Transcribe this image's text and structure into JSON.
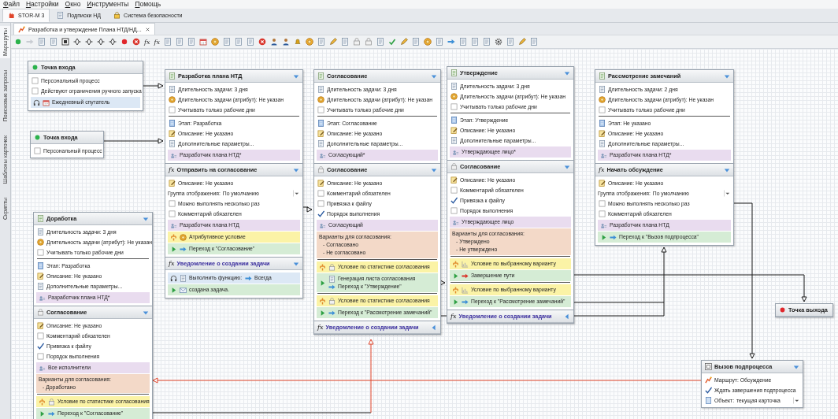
{
  "menu": [
    "Файл",
    "Настройки",
    "Окно",
    "Инструменты",
    "Помощь"
  ],
  "app_tabs": [
    {
      "label": "STOR-M 3",
      "selected": true
    },
    {
      "label": "Подписки НД",
      "selected": false
    },
    {
      "label": "Система безопасности",
      "selected": false
    }
  ],
  "sidebar": [
    {
      "label": "Маршруты",
      "selected": true
    },
    {
      "label": "Поисковые запросы",
      "selected": false
    },
    {
      "label": "Шаблоны карточек",
      "selected": false
    },
    {
      "label": "Скрипты",
      "selected": false
    }
  ],
  "document_tab": {
    "title": "Разработка и утверждение Плана НТД/НД...",
    "selected": true
  },
  "toolbar": {
    "function_labels": [
      "fx",
      "fx"
    ]
  },
  "nodes": [
    {
      "sections": [
        {
          "kind": "entry",
          "title": "Точка входа",
          "groups": [
            [
              {
                "kind": "check",
                "text": "Персональный процесс",
                "checked": false
              },
              {
                "kind": "check",
                "text": "Действуют ограничения ручного запуска",
                "checked": false
              },
              {
                "kind": "action",
                "steps": [
                  {
                    "kind": "calendar",
                    "text": "Ежедневный спутатель"
                  }
                ]
              }
            ]
          ]
        }
      ]
    },
    {
      "sections": [
        {
          "kind": "entry",
          "title": "Точка входа",
          "groups": [
            [
              {
                "kind": "check",
                "text": "Персональный процесс",
                "checked": false
              }
            ]
          ]
        }
      ]
    },
    {
      "sections": [
        {
          "kind": "task",
          "title": "Разработка плана НТД",
          "expanded": true,
          "groups": [
            [
              {
                "kind": "duration",
                "text": "Длительность задачи: 3 дня"
              },
              {
                "kind": "attribute",
                "text": "Длительность задачи (атрибут): Не указан"
              },
              {
                "kind": "check",
                "text": "Учитывать только рабочие дни",
                "checked": false
              }
            ],
            [
              {
                "kind": "stage",
                "text": "Этап: Разработка"
              },
              {
                "kind": "description",
                "text": "Описание: Не указано"
              },
              {
                "kind": "params",
                "text": "Дополнительные параметры..."
              },
              {
                "kind": "performer",
                "text": "Разработчик плана НТД*"
              }
            ]
          ]
        },
        {
          "kind": "function",
          "icon_text": "fx",
          "title": "Отправить на согласование",
          "expanded": true,
          "groups": [
            [
              {
                "kind": "description",
                "text": "Описание: Не указано"
              },
              {
                "kind": "select",
                "label": "Группа отображения:",
                "value": "По умолчанию"
              },
              {
                "kind": "check",
                "text": "Можно выполнять несколько раз",
                "checked": false
              },
              {
                "kind": "check",
                "text": "Комментарий обязателен",
                "checked": false
              },
              {
                "kind": "performer",
                "text": "Разработчик плана НТД"
              },
              {
                "kind": "condition",
                "steps": [
                  {
                    "kind": "attribute",
                    "text": "Атрибутивное условие"
                  }
                ]
              },
              {
                "kind": "transition",
                "steps": [
                  {
                    "kind": "goto",
                    "text": "Переход к \"Согласование\""
                  }
                ]
              }
            ]
          ]
        },
        {
          "kind": "notification",
          "icon_text": "fx",
          "title": "Уведомление о создании задачи",
          "expanded": true,
          "groups": [
            [
              {
                "kind": "action",
                "steps": [
                  {
                    "kind": "function",
                    "text": "Выполнить функцию:"
                  },
                  {
                    "kind": "goto",
                    "text": "Всегда"
                  }
                ]
              },
              {
                "kind": "transition",
                "steps": [
                  {
                    "kind": "mail",
                    "text": "создана задача."
                  }
                ]
              }
            ]
          ]
        }
      ]
    },
    {
      "sections": [
        {
          "kind": "task",
          "title": "Согласование",
          "expanded": true,
          "groups": [
            [
              {
                "kind": "duration",
                "text": "Длительность задачи: 3 дня"
              },
              {
                "kind": "attribute",
                "text": "Длительность задачи (атрибут): Не указан"
              },
              {
                "kind": "check",
                "text": "Учитывать только рабочие дни",
                "checked": false
              }
            ],
            [
              {
                "kind": "stage",
                "text": "Этап: Согласование"
              },
              {
                "kind": "description",
                "text": "Описание: Не указано"
              },
              {
                "kind": "params",
                "text": "Дополнительные параметры..."
              },
              {
                "kind": "performer",
                "text": "Согласующий*"
              }
            ]
          ]
        },
        {
          "kind": "approval",
          "title": "Согласование",
          "expanded": true,
          "groups": [
            [
              {
                "kind": "description",
                "text": "Описание: Не указано"
              },
              {
                "kind": "check",
                "text": "Комментарий обязателен",
                "checked": false
              },
              {
                "kind": "check",
                "text": "Привязка к файлу",
                "checked": false
              },
              {
                "kind": "check",
                "text": "Порядок выполнения",
                "checked": true
              },
              {
                "kind": "performer",
                "text": "Согласующий"
              },
              {
                "kind": "variants",
                "title": "Варианты для согласования:",
                "options": [
                  "- Согласовано",
                  "- Не согласовано"
                ]
              }
            ],
            [
              {
                "kind": "condition",
                "steps": [
                  {
                    "kind": "statistics",
                    "text": "Условие по статистике согласования"
                  }
                ]
              },
              {
                "kind": "transition",
                "steps": [
                  {
                    "kind": "generate",
                    "text": "Генерация листа согласования"
                  },
                  {
                    "kind": "goto",
                    "text": "Переход к \"Утверждение\""
                  }
                ]
              }
            ],
            [
              {
                "kind": "condition",
                "steps": [
                  {
                    "kind": "statistics",
                    "text": "Условие по статистике согласования"
                  }
                ]
              },
              {
                "kind": "transition",
                "steps": [
                  {
                    "kind": "goto",
                    "text": "Переход к \"Рассмотрение замечаний\""
                  }
                ]
              }
            ]
          ]
        },
        {
          "kind": "notification",
          "icon_text": "fx",
          "title": "Уведомление о создании задачи",
          "expanded": false
        }
      ]
    },
    {
      "sections": [
        {
          "kind": "task",
          "title": "Утверждение",
          "expanded": true,
          "groups": [
            [
              {
                "kind": "duration",
                "text": "Длительность задачи: 3 дня"
              },
              {
                "kind": "attribute",
                "text": "Длительность задачи (атрибут): Не указан"
              },
              {
                "kind": "check",
                "text": "Учитывать только рабочие дни",
                "checked": false
              }
            ],
            [
              {
                "kind": "stage",
                "text": "Этап: Утверждение"
              },
              {
                "kind": "description",
                "text": "Описание: Не указано"
              },
              {
                "kind": "params",
                "text": "Дополнительные параметры..."
              },
              {
                "kind": "performer",
                "text": "Утверждающее лицо*"
              }
            ]
          ]
        },
        {
          "kind": "approval",
          "title": "Согласование",
          "expanded": true,
          "groups": [
            [
              {
                "kind": "description",
                "text": "Описание: Не указано"
              },
              {
                "kind": "check",
                "text": "Комментарий обязателен",
                "checked": false
              },
              {
                "kind": "check",
                "text": "Привязка к файлу",
                "checked": true
              },
              {
                "kind": "check",
                "text": "Порядок выполнения",
                "checked": false
              },
              {
                "kind": "performer",
                "text": "Утверждающее лицо"
              },
              {
                "kind": "variants",
                "title": "Варианты для согласования:",
                "options": [
                  "- Утверждено",
                  "- Не утверждено"
                ]
              }
            ],
            [
              {
                "kind": "condition",
                "steps": [
                  {
                    "kind": "choice",
                    "text": "Условие по выбранному варианту"
                  }
                ]
              },
              {
                "kind": "transition",
                "steps": [
                  {
                    "kind": "finish",
                    "text": "Завершение пути"
                  }
                ]
              }
            ],
            [
              {
                "kind": "condition",
                "steps": [
                  {
                    "kind": "choice",
                    "text": "Условие по выбранному варианту"
                  }
                ]
              },
              {
                "kind": "transition",
                "steps": [
                  {
                    "kind": "goto",
                    "text": "Переход к \"Рассмотрение замечаний\""
                  }
                ]
              }
            ]
          ]
        },
        {
          "kind": "notification",
          "icon_text": "fx",
          "title": "Уведомление о создании задачи",
          "expanded": false
        }
      ]
    },
    {
      "sections": [
        {
          "kind": "task",
          "title": "Рассмотрение замечаний",
          "expanded": true,
          "groups": [
            [
              {
                "kind": "duration",
                "text": "Длительность задачи: 2 дня"
              },
              {
                "kind": "attribute",
                "text": "Длительность задачи (атрибут): Не указан"
              },
              {
                "kind": "check",
                "text": "Учитывать только рабочие дни",
                "checked": false
              }
            ],
            [
              {
                "kind": "stage",
                "text": "Этап: Не указано"
              },
              {
                "kind": "description",
                "text": "Описание: Не указано"
              },
              {
                "kind": "params",
                "text": "Дополнительные параметры..."
              },
              {
                "kind": "performer",
                "text": "Разработчик плана НТД*"
              }
            ]
          ]
        },
        {
          "kind": "function",
          "icon_text": "fx",
          "title": "Начать обсуждение",
          "expanded": true,
          "groups": [
            [
              {
                "kind": "description",
                "text": "Описание: Не указано"
              },
              {
                "kind": "select",
                "label": "Группа отображения:",
                "value": "По умолчанию"
              },
              {
                "kind": "check",
                "text": "Можно выполнять несколько раз",
                "checked": false
              },
              {
                "kind": "check",
                "text": "Комментарий обязателен",
                "checked": false
              },
              {
                "kind": "performer",
                "text": "Разработчик плана НТД"
              },
              {
                "kind": "transition",
                "steps": [
                  {
                    "kind": "goto",
                    "text": "Переход к \"Вызов подпроцесса\""
                  }
                ]
              }
            ]
          ]
        }
      ]
    },
    {
      "sections": [
        {
          "kind": "task",
          "title": "Доработка",
          "expanded": true,
          "groups": [
            [
              {
                "kind": "duration",
                "text": "Длительность задачи: 3 дня"
              },
              {
                "kind": "attribute",
                "text": "Длительность задачи (атрибут): Не указан"
              },
              {
                "kind": "check",
                "text": "Учитывать только рабочие дни",
                "checked": false
              }
            ],
            [
              {
                "kind": "stage",
                "text": "Этап: Разработка"
              },
              {
                "kind": "description",
                "text": "Описание: Не указано"
              },
              {
                "kind": "params",
                "text": "Дополнительные параметры..."
              },
              {
                "kind": "performer",
                "text": "Разработчик плана НТД*"
              }
            ]
          ]
        },
        {
          "kind": "approval",
          "title": "Согласование",
          "expanded": true,
          "groups": [
            [
              {
                "kind": "description",
                "text": "Описание: Не указано"
              },
              {
                "kind": "check",
                "text": "Комментарий обязателен",
                "checked": false
              },
              {
                "kind": "check",
                "text": "Привязка к файлу",
                "checked": true
              },
              {
                "kind": "check",
                "text": "Порядок выполнения",
                "checked": false
              },
              {
                "kind": "performer",
                "text": "Все исполнители"
              },
              {
                "kind": "variants",
                "title": "Варианты для согласования:",
                "options": [
                  "- Доработано"
                ]
              }
            ],
            [
              {
                "kind": "condition",
                "steps": [
                  {
                    "kind": "statistics",
                    "text": "Условие по статистике согласования"
                  }
                ]
              },
              {
                "kind": "transition",
                "steps": [
                  {
                    "kind": "goto",
                    "text": "Переход к \"Согласование\""
                  }
                ]
              }
            ]
          ]
        }
      ]
    },
    {
      "sections": [
        {
          "kind": "exit",
          "title": "Точка выхода"
        }
      ]
    },
    {
      "sections": [
        {
          "kind": "subprocess",
          "title": "Вызов подпроцесса",
          "expanded": true,
          "groups": [
            [
              {
                "kind": "route",
                "text": "Маршрут: Обсуждение"
              },
              {
                "kind": "check",
                "text": "Ждать завершения подпроцесса",
                "checked": true
              },
              {
                "kind": "object",
                "label": "Объект:",
                "value": "текущая карточка"
              }
            ]
          ]
        }
      ]
    }
  ]
}
